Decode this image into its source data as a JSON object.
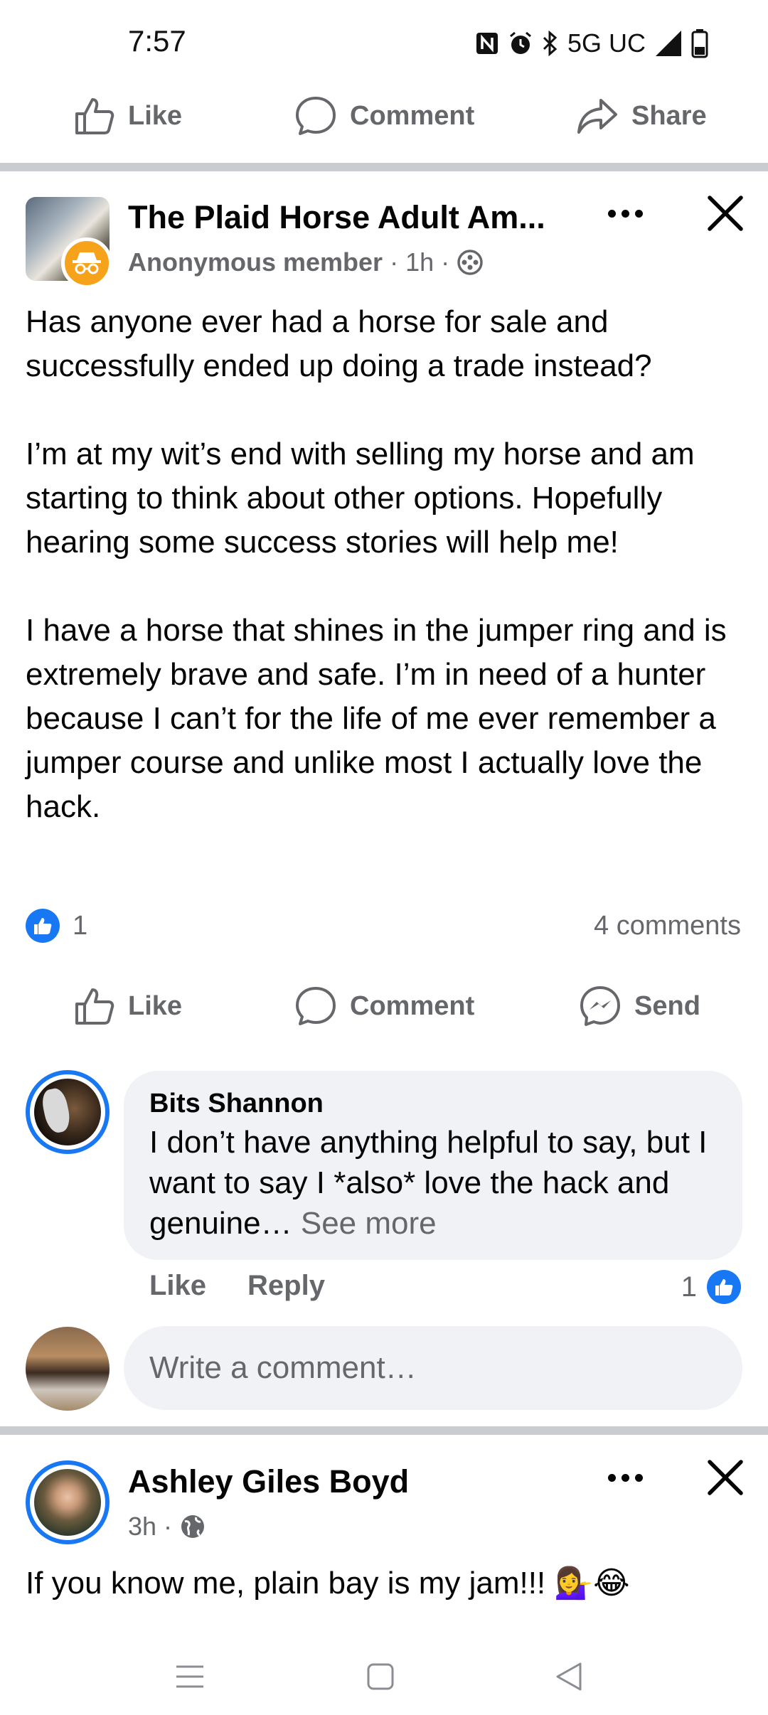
{
  "status_bar": {
    "time": "7:57",
    "nfc_icon": "nfc-icon",
    "network": "5G UC",
    "icons": [
      "nfc-icon",
      "alarm-icon",
      "bluetooth-icon",
      "signal-icon",
      "battery-icon"
    ]
  },
  "top_actions": {
    "like": "Like",
    "comment": "Comment",
    "share": "Share"
  },
  "post": {
    "group_name": "The Plaid Horse Adult Am...",
    "author": "Anonymous member",
    "time": "1h",
    "separator": "·",
    "paragraphs": [
      "Has anyone ever had a horse for sale and successfully ended up doing a trade instead?",
      "I’m at my wit’s end with selling my horse and am starting to think about other options. Hopefully hearing some success stories will help me!",
      "I have a horse that shines in the jumper ring and is extremely brave and safe. I’m in need of a hunter because I can’t for the life of me ever remember a jumper course and unlike most I actually love the hack."
    ],
    "reaction_count": "1",
    "comments_count": "4 comments",
    "actions": {
      "like": "Like",
      "comment": "Comment",
      "send": "Send"
    }
  },
  "comment": {
    "name": "Bits Shannon",
    "text": "I don’t have anything helpful to say, but I want to say I *also* love the hack and genuine…",
    "see_more": "See more",
    "like": "Like",
    "reply": "Reply",
    "reaction_count": "1"
  },
  "composer": {
    "placeholder": "Write a comment…"
  },
  "post2": {
    "author": "Ashley Giles Boyd",
    "time": "3h",
    "separator": "·",
    "text": "If you know me, plain bay is my jam!!! 💁‍♀️😂"
  },
  "colors": {
    "accent": "#1877f2",
    "muted_text": "#65676b",
    "bubble": "#f0f2f5",
    "divider": "#c9ccd1",
    "anon_badge": "#f7a21b"
  }
}
